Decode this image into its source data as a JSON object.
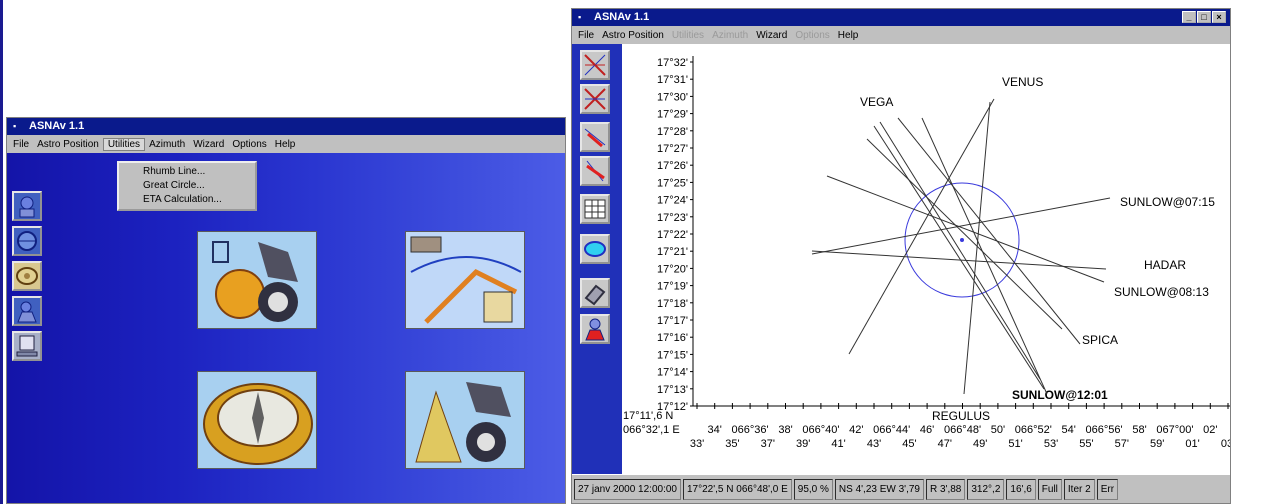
{
  "left_window": {
    "title": "ASNAv 1.1",
    "menu": [
      "File",
      "Astro Position",
      "Utilities",
      "Azimuth",
      "Wizard",
      "Options",
      "Help"
    ],
    "active_menu": "Utilities",
    "dropdown": [
      "Rhumb Line...",
      "Great Circle...",
      "ETA Calculation..."
    ]
  },
  "right_window": {
    "title": "ASNAv 1.1",
    "menu": [
      {
        "label": "File",
        "disabled": false
      },
      {
        "label": "Astro Position",
        "disabled": false
      },
      {
        "label": "Utilities",
        "disabled": true
      },
      {
        "label": "Azimuth",
        "disabled": true
      },
      {
        "label": "Wizard",
        "disabled": false
      },
      {
        "label": "Options",
        "disabled": true
      },
      {
        "label": "Help",
        "disabled": false
      }
    ],
    "status": [
      "27 janv 2000 12:00:00",
      "17°22',5 N 066°48',0 E",
      "95,0 %",
      "NS 4',23 EW 3',79",
      "R 3',88",
      "312°,2",
      "16',6",
      "Full",
      "Iter 2",
      "Err"
    ]
  },
  "chart_data": {
    "type": "line",
    "y_ticks": [
      "17°32'",
      "17°31'",
      "17°30'",
      "17°29'",
      "17°28'",
      "17°27'",
      "17°26'",
      "17°25'",
      "17°24'",
      "17°23'",
      "17°22'",
      "17°21'",
      "17°20'",
      "17°19'",
      "17°18'",
      "17°17'",
      "17°16'",
      "17°15'",
      "17°14'",
      "17°13'",
      "17°12'"
    ],
    "origin_lat": "17°11',6 N",
    "origin_lon": "066°32',1 E",
    "x_ticks_upper": [
      "34'",
      "066°36'",
      "38'",
      "066°40'",
      "42'",
      "066°44'",
      "46'",
      "066°48'",
      "50'",
      "066°52'",
      "54'",
      "066°56'",
      "58'",
      "067°00'",
      "02'"
    ],
    "x_ticks_lower": [
      "33'",
      "35'",
      "37'",
      "39'",
      "41'",
      "43'",
      "45'",
      "47'",
      "49'",
      "51'",
      "53'",
      "55'",
      "57'",
      "59'",
      "01'",
      "03'"
    ],
    "lines_of_position": [
      {
        "label": "VENUS",
        "bold": false
      },
      {
        "label": "VEGA",
        "bold": false
      },
      {
        "label": "SUNLOW@07:15",
        "bold": false
      },
      {
        "label": "HADAR",
        "bold": false
      },
      {
        "label": "SUNLOW@08:13",
        "bold": false
      },
      {
        "label": "SPICA",
        "bold": false
      },
      {
        "label": "SUNLOW@12:01",
        "bold": true
      },
      {
        "label": "REGULUS",
        "bold": false
      }
    ],
    "colors": {
      "lines": "#333333",
      "circle": "#3a3adc",
      "axis": "#000000"
    }
  }
}
